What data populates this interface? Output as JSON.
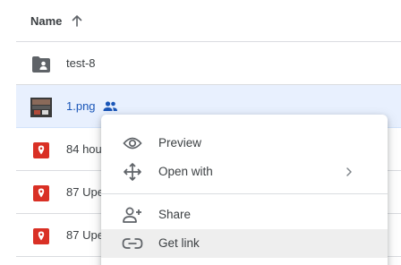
{
  "header": {
    "name_label": "Name",
    "sort_icon": "arrow-up-icon"
  },
  "rows": [
    {
      "name": "test-8",
      "icon": "shared-folder-icon",
      "selected": false
    },
    {
      "name": "1.png",
      "icon": "image-thumbnail-icon",
      "selected": true,
      "shared": true
    },
    {
      "name": "84 hou",
      "icon": "map-pin-icon",
      "selected": false
    },
    {
      "name": "87 Upe",
      "icon": "map-pin-icon",
      "selected": false
    },
    {
      "name": "87 Upe",
      "icon": "map-pin-icon",
      "selected": false
    }
  ],
  "context_menu": {
    "items": [
      {
        "label": "Preview",
        "icon": "eye-icon"
      },
      {
        "label": "Open with",
        "icon": "move-arrows-icon",
        "has_submenu": true
      },
      {
        "label": "Share",
        "icon": "person-add-icon"
      },
      {
        "label": "Get link",
        "icon": "link-icon",
        "highlighted": true
      }
    ]
  },
  "colors": {
    "selected_row_bg": "#e8f0fe",
    "selected_text": "#1a56b8",
    "map_pin_red": "#d93025",
    "menu_hover_bg": "#eeeeee"
  }
}
